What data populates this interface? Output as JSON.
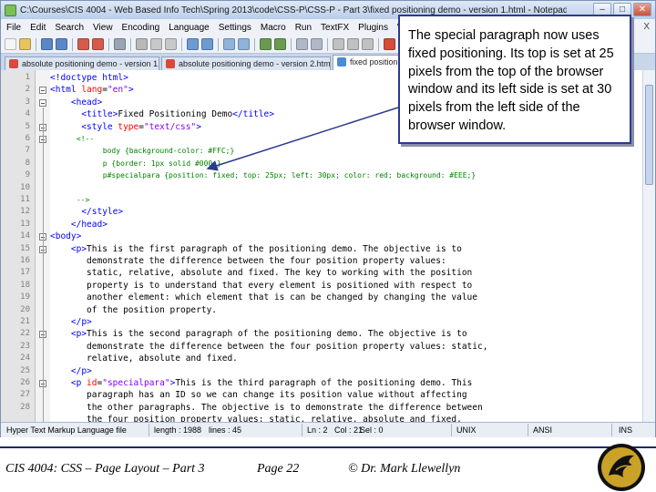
{
  "window": {
    "title": "C:\\Courses\\CIS 4004 - Web Based Info Tech\\Spring 2013\\code\\CSS-P\\CSS-P - Part 3\\fixed positioning demo - version 1.html - Notepad++",
    "controls": {
      "minimize": "–",
      "restore": "□",
      "close": "✕"
    }
  },
  "menu": {
    "items": [
      "File",
      "Edit",
      "Search",
      "View",
      "Encoding",
      "Language",
      "Settings",
      "Macro",
      "Run",
      "TextFX",
      "Plugins",
      "Window",
      "?"
    ],
    "close": "X"
  },
  "toolbar": {
    "icon_names": [
      "new-icon",
      "open-icon",
      "save-icon",
      "save-all-icon",
      "close-icon",
      "close-all-icon",
      "print-icon",
      "cut-icon",
      "copy-icon",
      "paste-icon",
      "undo-icon",
      "redo-icon",
      "find-icon",
      "replace-icon",
      "zoom-in-icon",
      "zoom-out-icon",
      "sync-v-icon",
      "sync-h-icon",
      "wrap-icon",
      "all-chars-icon",
      "indent-guide-icon",
      "record-icon",
      "stop-icon",
      "play-icon",
      "playback-icon",
      "save-macro-icon"
    ],
    "colors": [
      "#f4f4f4",
      "#e8c25c",
      "#5a87c6",
      "#5a87c6",
      "#d65a4a",
      "#d65a4a",
      "#9aa4b2",
      "#b8b8b8",
      "#c8c8c8",
      "#c8c8c8",
      "#6c9bd2",
      "#6c9bd2",
      "#8fb3da",
      "#8fb3da",
      "#6a9a50",
      "#6a9a50",
      "#b0b8c8",
      "#b0b8c8",
      "#c0c0c0",
      "#c0c0c0",
      "#c0c0c0",
      "#d84a3a",
      "#505050",
      "#4a8a3a",
      "#4a8a3a",
      "#6c9bd2"
    ]
  },
  "tabs": [
    {
      "label": "absolute positioning demo - version 1.html"
    },
    {
      "label": "absolute positioning demo - version 2.html"
    },
    {
      "label": "fixed positioning demo - version 1.html"
    }
  ],
  "editor": {
    "line_numbers": [
      "1",
      "2",
      "3",
      "4",
      "5",
      "6",
      "7",
      "8",
      "9",
      "10",
      "11",
      "12",
      "13",
      "14",
      "15",
      "16",
      "17",
      "18",
      "19",
      "20",
      "21",
      "22",
      "23",
      "24",
      "25",
      "26",
      "27",
      "28"
    ],
    "lines": [
      [
        {
          "t": "<!doctype html>",
          "c": "tag"
        }
      ],
      [
        {
          "t": "<html ",
          "c": "tag"
        },
        {
          "t": "lang",
          "c": "attr"
        },
        {
          "t": "=",
          "c": "txt"
        },
        {
          "t": "\"en\"",
          "c": "val"
        },
        {
          "t": ">",
          "c": "tag"
        }
      ],
      [
        {
          "t": "    <head>",
          "c": "tag"
        }
      ],
      [
        {
          "t": "      <title>",
          "c": "tag"
        },
        {
          "t": "Fixed Positioning Demo",
          "c": "txt"
        },
        {
          "t": "</title>",
          "c": "tag"
        }
      ],
      [
        {
          "t": "      <style ",
          "c": "tag"
        },
        {
          "t": "type",
          "c": "attr"
        },
        {
          "t": "=",
          "c": "txt"
        },
        {
          "t": "\"text/css\"",
          "c": "val"
        },
        {
          "t": ">",
          "c": "tag"
        }
      ],
      [
        {
          "t": "      <!--",
          "c": "cmt"
        }
      ],
      [
        {
          "t": "            body {background-color: #FFC;}",
          "c": "cmt"
        }
      ],
      [
        {
          "t": "            p {border: 1px solid #000;}",
          "c": "cmt"
        }
      ],
      [
        {
          "t": "            p#specialpara {position: fixed; top: 25px; left: 30px; color: red; background: #EEE;}",
          "c": "cmt"
        }
      ],
      [
        {
          "t": "",
          "c": "txt"
        }
      ],
      [
        {
          "t": "      -->",
          "c": "cmt"
        }
      ],
      [
        {
          "t": "      </style>",
          "c": "tag"
        }
      ],
      [
        {
          "t": "    </head>",
          "c": "tag"
        }
      ],
      [
        {
          "t": "<body>",
          "c": "tag"
        }
      ],
      [
        {
          "t": "    <p>",
          "c": "tag"
        },
        {
          "t": "This is the first paragraph of the positioning demo. The objective is to",
          "c": "txt"
        }
      ],
      [
        {
          "t": "       demonstrate the difference between the four position property values:",
          "c": "txt"
        }
      ],
      [
        {
          "t": "       static, relative, absolute and fixed. The key to working with the position",
          "c": "txt"
        }
      ],
      [
        {
          "t": "       property is to understand that every element is positioned with respect to",
          "c": "txt"
        }
      ],
      [
        {
          "t": "       another element: which element that is can be changed by changing the value",
          "c": "txt"
        }
      ],
      [
        {
          "t": "       of the position property.",
          "c": "txt"
        }
      ],
      [
        {
          "t": "    </p>",
          "c": "tag"
        }
      ],
      [
        {
          "t": "    <p>",
          "c": "tag"
        },
        {
          "t": "This is the second paragraph of the positioning demo. The objective is to",
          "c": "txt"
        }
      ],
      [
        {
          "t": "       demonstrate the difference between the four position property values: static,",
          "c": "txt"
        }
      ],
      [
        {
          "t": "       relative, absolute and fixed.",
          "c": "txt"
        }
      ],
      [
        {
          "t": "    </p>",
          "c": "tag"
        }
      ],
      [
        {
          "t": "    <p ",
          "c": "tag"
        },
        {
          "t": "id",
          "c": "attr"
        },
        {
          "t": "=",
          "c": "txt"
        },
        {
          "t": "\"specialpara\"",
          "c": "val"
        },
        {
          "t": ">",
          "c": "tag"
        },
        {
          "t": "This is the third paragraph of the positioning demo. This",
          "c": "txt"
        }
      ],
      [
        {
          "t": "       paragraph has an ID so we can change its position value without affecting",
          "c": "txt"
        }
      ],
      [
        {
          "t": "       the other paragraphs. The objective is to demonstrate the difference between",
          "c": "txt"
        }
      ],
      [
        {
          "t": "       the four position property values: static, relative, absolute and fixed.",
          "c": "txt"
        }
      ]
    ]
  },
  "status": {
    "file_type": "Hyper Text Markup Language file",
    "length": "length : 1988",
    "lines": "lines : 45",
    "ln": "Ln : 2",
    "col": "Col : 21",
    "sel": "Sel : 0",
    "eol": "UNIX",
    "encoding": "ANSI",
    "mode": "INS"
  },
  "callout": {
    "text": "The special paragraph now uses fixed positioning.  Its top is set at 25 pixels from the top of the browser window and its left side is set at 30 pixels from the left side of the browser window."
  },
  "footer": {
    "course": "CIS 4004: CSS – Page Layout – Part 3",
    "page": "Page 22",
    "author": "© Dr. Mark Llewellyn"
  },
  "colors": {
    "callout_border": "#2b3a8c",
    "footer_rule": "#1a2a6c",
    "logo_gold": "#c9a227",
    "logo_black": "#111111"
  }
}
